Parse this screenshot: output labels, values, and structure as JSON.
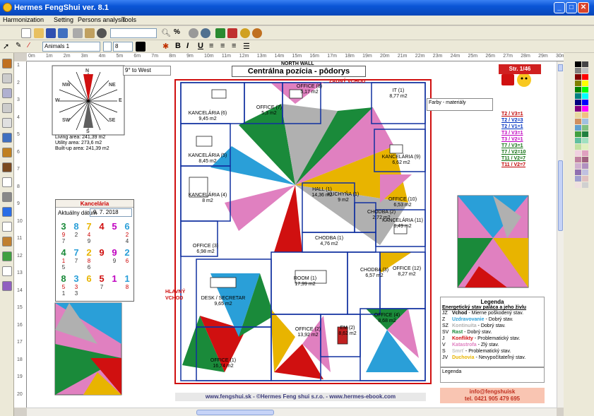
{
  "window": {
    "title": "Hermes FengShui ver. 8.1"
  },
  "menu": [
    "Harmonization",
    "Setting",
    "Persons analysis",
    "Tools"
  ],
  "toolbar": {
    "search_value": "",
    "animal_select": "Animals 1",
    "font_size": "8",
    "bold": "B",
    "italic": "I",
    "underline": "U"
  },
  "ruler": {
    "top": [
      "0m",
      "1m",
      "2m",
      "3m",
      "4m",
      "5m",
      "6m",
      "7m",
      "8m",
      "9m",
      "10m",
      "11m",
      "12m",
      "13m",
      "14m",
      "15m",
      "16m",
      "17m",
      "18m",
      "19m",
      "20m",
      "21m",
      "22m",
      "23m",
      "24m",
      "25m",
      "26m",
      "27m",
      "28m",
      "29m",
      "30m"
    ],
    "left": [
      "1",
      "2",
      "3",
      "4",
      "5",
      "6",
      "7",
      "8",
      "9",
      "10",
      "11",
      "12",
      "13",
      "14",
      "15",
      "16",
      "17",
      "18",
      "19",
      "20"
    ]
  },
  "compass": {
    "directions": [
      "NW",
      "N",
      "NE",
      "W",
      "E",
      "SW",
      "S",
      "SE"
    ],
    "orientation": "9° to West"
  },
  "areas": {
    "living": "Living area: 241,39 m2",
    "utility": "Utility area: 273,6 m2",
    "built": "Built-up area: 241,39 m2"
  },
  "plan": {
    "title": "Centrálna pozícia - pôdorys",
    "north": "NORTH WALL",
    "back_entrance": "ZADNÝ VCHOD",
    "main_entrance": "HLAVNÝ VCHOD",
    "rooms": [
      {
        "name": "KANCELÁRIA (6)",
        "area": "9,45 m2"
      },
      {
        "name": "OFFICE (7)",
        "area": "5,3 m2"
      },
      {
        "name": "OFFICE (8)",
        "area": "5,17 m2"
      },
      {
        "name": "IT (1)",
        "area": "8,77 m2"
      },
      {
        "name": "KANCELÁRIA (5)",
        "area": "8,45 m2"
      },
      {
        "name": "KANCELÁRIA (9)",
        "area": "6,62 m2"
      },
      {
        "name": "KANCELÁRIA (4)",
        "area": "8 m2"
      },
      {
        "name": "HALL (1)",
        "area": "14,36 m2"
      },
      {
        "name": "KUCHYŇA (1)",
        "area": "9 m2"
      },
      {
        "name": "CHODBA (2)",
        "area": "2,72 m2"
      },
      {
        "name": "OFFICE (10)",
        "area": "6,53 m2"
      },
      {
        "name": "KANCELÁRIA (11)",
        "area": "6,49 m2"
      },
      {
        "name": "OFFICE (3)",
        "area": "6,98 m2"
      },
      {
        "name": "CHODBA (1)",
        "area": "4,76 m2"
      },
      {
        "name": "ROOM (1)",
        "area": "17,99 m2"
      },
      {
        "name": "CHODBA (3)",
        "area": "6,57 m2"
      },
      {
        "name": "OFFICE (12)",
        "area": "8,27 m2"
      },
      {
        "name": "DESK / SECRETAR",
        "area": "9,65 m2"
      },
      {
        "name": "OFFICE (2)",
        "area": "13,92 m2"
      },
      {
        "name": "EM (2)",
        "area": "8,62 m2"
      },
      {
        "name": "OFFICE (4)",
        "area": "8,68 m2"
      },
      {
        "name": "OFFICE (1)",
        "area": "16,74 m2"
      }
    ]
  },
  "page": {
    "label": "Str. 1/46"
  },
  "materials": {
    "label": "Farby - materiály"
  },
  "stars": [
    "T2 / V3=1",
    "T2 / V2=3",
    "T2 / V1=1",
    "T3 / V3=1",
    "T3 / V2=1",
    "T7 / V3=1",
    "T7 / V2=10",
    "T11 / V2=7",
    "T11 / V2=7"
  ],
  "calendar": {
    "title": "Kancelária",
    "date_label": "Aktuálny dátum",
    "date": "9. 7. 2018",
    "cells": [
      {
        "big": "3",
        "a": "9",
        "b": "7"
      },
      {
        "big": "8",
        "a": "",
        "b": "2"
      },
      {
        "big": "7",
        "a": "4",
        "b": "9"
      },
      {
        "big": "4",
        "a": "",
        "b": ""
      },
      {
        "big": "5",
        "a": "",
        "b": ""
      },
      {
        "big": "6",
        "a": "2",
        "b": "4"
      },
      {
        "big": "4",
        "a": "1",
        "b": "5"
      },
      {
        "big": "7",
        "a": "",
        "b": "7"
      },
      {
        "big": "2",
        "a": "8",
        "b": "6"
      },
      {
        "big": "9",
        "a": "",
        "b": ""
      },
      {
        "big": "9",
        "a": "",
        "b": "9"
      },
      {
        "big": "2",
        "a": "6",
        "b": ""
      },
      {
        "big": "8",
        "a": "5",
        "b": "1"
      },
      {
        "big": "3",
        "a": "3",
        "b": "3"
      },
      {
        "big": "6",
        "a": "",
        "b": ""
      },
      {
        "big": "5",
        "a": "",
        "b": "7"
      },
      {
        "big": "1",
        "a": "",
        "b": ""
      },
      {
        "big": "1",
        "a": "8",
        "b": ""
      }
    ]
  },
  "legend": {
    "title": "Legenda",
    "subtitle": "Energetický stav paláca a jeho živlu",
    "items": [
      {
        "code": "JZ",
        "name": "Vchod",
        "desc": "- Mierne poškodený stav.",
        "color": "#000000"
      },
      {
        "code": "Z",
        "name": "Uzdravovanie",
        "desc": "- Dobrý stav.",
        "color": "#2a9fd8"
      },
      {
        "code": "SZ",
        "name": "Kontinuita",
        "desc": "- Dobrý stav.",
        "color": "#b0b0b0"
      },
      {
        "code": "SV",
        "name": "Rast",
        "desc": "- Dobrý stav.",
        "color": "#1a8a3a"
      },
      {
        "code": "J",
        "name": "Konflikty",
        "desc": "- Problematický stav.",
        "color": "#d01010"
      },
      {
        "code": "V",
        "name": "Katastrofa",
        "desc": "- Zlý stav.",
        "color": "#e080c0"
      },
      {
        "code": "S",
        "name": "Smrť",
        "desc": "- Problematický stav.",
        "color": "#c0c0c0"
      },
      {
        "code": "JV",
        "name": "Duchovia",
        "desc": "- Nevypočítateľný stav.",
        "color": "#e8b400"
      }
    ],
    "note": "Legenda"
  },
  "contact": {
    "email": "info@fengshuisk",
    "phone": "tel. 0421 905 479 695"
  },
  "footer": {
    "text": "www.fengshui.sk   -   ©Hermes Feng shui s.r.o.   -   www.hermes-ebook.com"
  }
}
